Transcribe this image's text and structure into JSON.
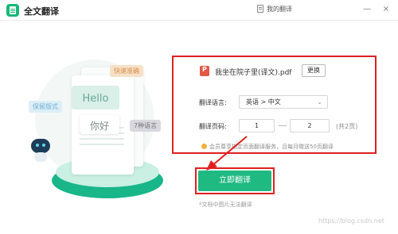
{
  "app": {
    "title": "全文翻译",
    "my_translations": "我的翻译",
    "window_controls": {
      "minimize": "—",
      "close": "×"
    },
    "accent_color": "#1fb982",
    "highlight_color": "#e02020"
  },
  "illustration": {
    "hello": "Hello",
    "nihao": "你好",
    "tag_fast": "快速准确",
    "tag_keep_format": "保留版式",
    "tag_languages": "7种语言"
  },
  "file": {
    "name": "我坐在院子里(译文).pdf",
    "change_label": "更换"
  },
  "settings": {
    "language_label": "翻译语言:",
    "language_value": "英语 > 中文",
    "pages_label": "翻译页码:",
    "page_from": "1",
    "page_to": "2",
    "total_pages": "(共2页)"
  },
  "vip_note": "会员尊享指定页面翻译服务，且每月赠送50页翻译",
  "translate_button": "立即翻译",
  "foot_note": "*文档中图片无法翻译",
  "watermark": "https://blog.csdn.net"
}
